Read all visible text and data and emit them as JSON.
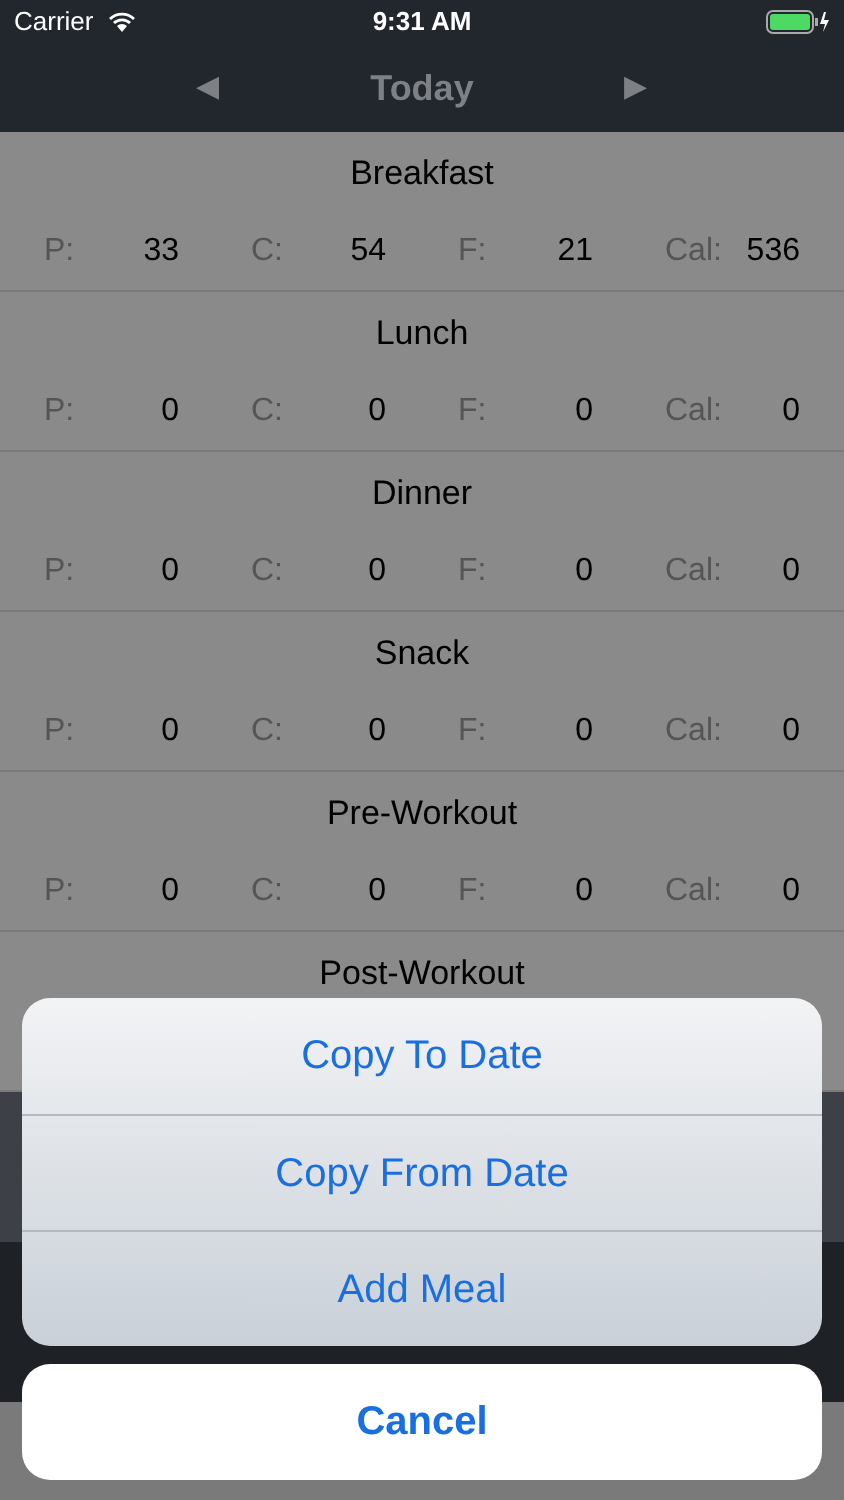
{
  "status_bar": {
    "carrier": "Carrier",
    "time": "9:31 AM"
  },
  "nav": {
    "prev": "◀",
    "title": "Today",
    "next": "▶"
  },
  "meals": [
    {
      "name": "Breakfast",
      "macros": [
        {
          "label": "P:",
          "value": "33"
        },
        {
          "label": "C:",
          "value": "54"
        },
        {
          "label": "F:",
          "value": "21"
        },
        {
          "label": "Cal:",
          "value": "536"
        }
      ]
    },
    {
      "name": "Lunch",
      "macros": [
        {
          "label": "P:",
          "value": "0"
        },
        {
          "label": "C:",
          "value": "0"
        },
        {
          "label": "F:",
          "value": "0"
        },
        {
          "label": "Cal:",
          "value": "0"
        }
      ]
    },
    {
      "name": "Dinner",
      "macros": [
        {
          "label": "P:",
          "value": "0"
        },
        {
          "label": "C:",
          "value": "0"
        },
        {
          "label": "F:",
          "value": "0"
        },
        {
          "label": "Cal:",
          "value": "0"
        }
      ]
    },
    {
      "name": "Snack",
      "macros": [
        {
          "label": "P:",
          "value": "0"
        },
        {
          "label": "C:",
          "value": "0"
        },
        {
          "label": "F:",
          "value": "0"
        },
        {
          "label": "Cal:",
          "value": "0"
        }
      ]
    },
    {
      "name": "Pre-Workout",
      "macros": [
        {
          "label": "P:",
          "value": "0"
        },
        {
          "label": "C:",
          "value": "0"
        },
        {
          "label": "F:",
          "value": "0"
        },
        {
          "label": "Cal:",
          "value": "0"
        }
      ]
    },
    {
      "name": "Post-Workout"
    }
  ],
  "action_sheet": {
    "actions": [
      "Copy To Date",
      "Copy From Date",
      "Add Meal"
    ],
    "cancel": "Cancel"
  }
}
